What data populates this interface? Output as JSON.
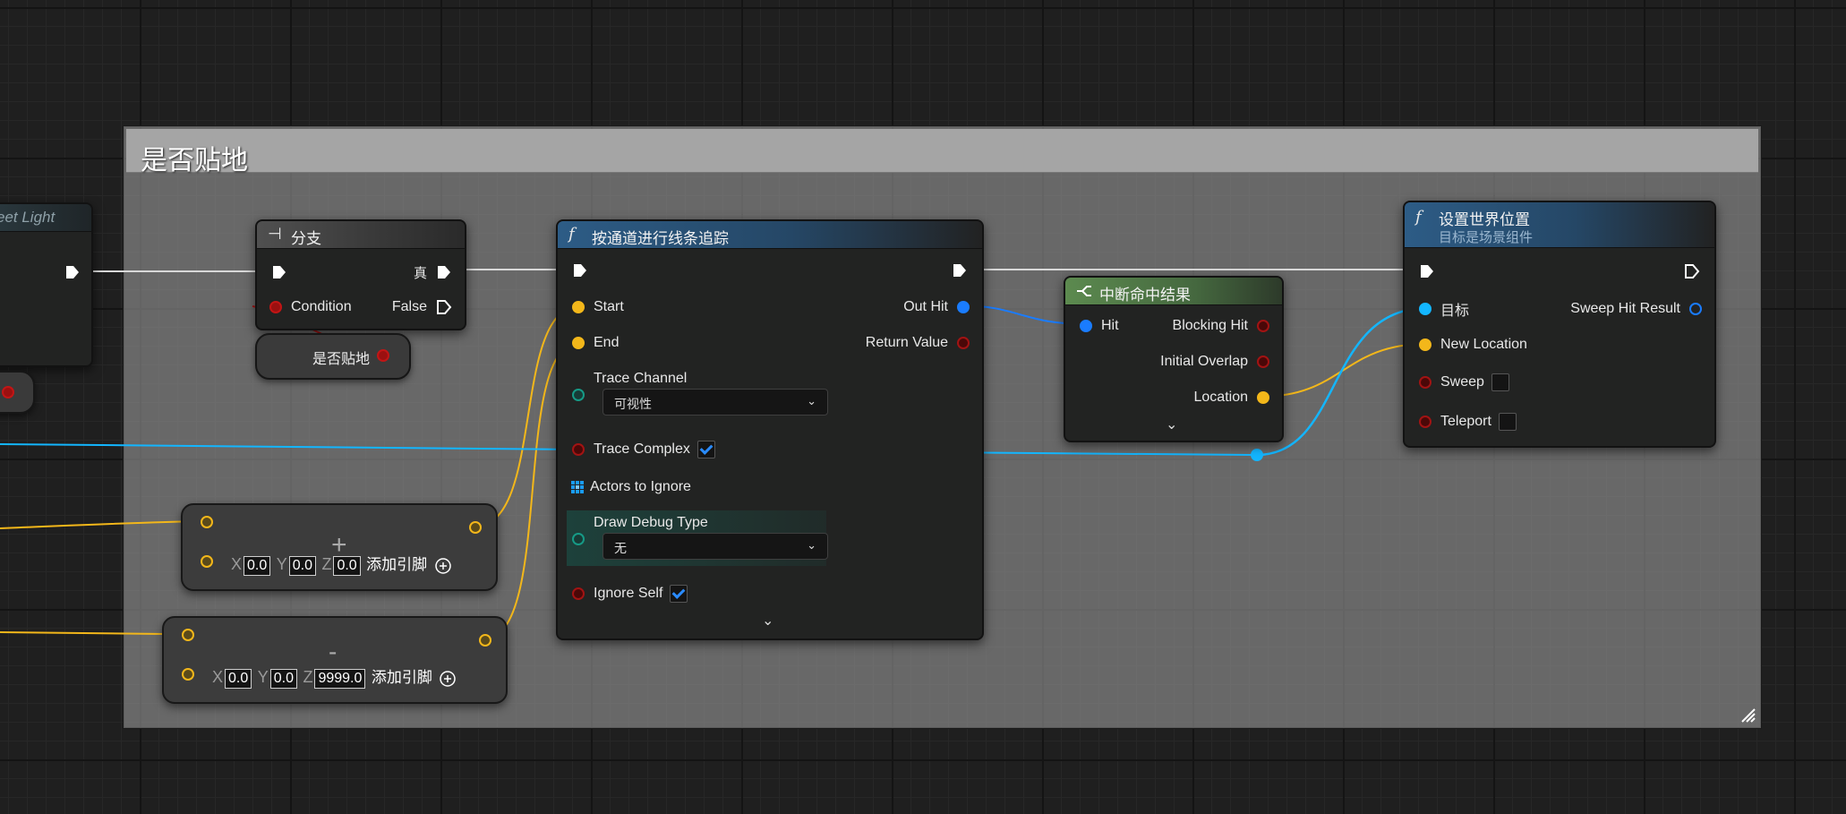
{
  "comment": {
    "title": "是否贴地"
  },
  "left_stub": {
    "title": "eet Light"
  },
  "branch_node": {
    "title": "分支",
    "exec_in": "",
    "true_label": "真",
    "condition_label": "Condition",
    "false_label": "False"
  },
  "variable_node": {
    "label": "是否贴地"
  },
  "line_trace": {
    "title": "按通道进行线条追踪",
    "start_label": "Start",
    "end_label": "End",
    "out_hit_label": "Out Hit",
    "return_value_label": "Return Value",
    "trace_channel_label": "Trace Channel",
    "trace_channel_value": "可视性",
    "trace_complex_label": "Trace Complex",
    "trace_complex_checked": true,
    "actors_to_ignore_label": "Actors to Ignore",
    "draw_debug_label": "Draw Debug Type",
    "draw_debug_value": "无",
    "ignore_self_label": "Ignore Self",
    "ignore_self_checked": true
  },
  "break_hit": {
    "title": "中断命中结果",
    "hit_label": "Hit",
    "blocking_hit_label": "Blocking Hit",
    "initial_overlap_label": "Initial Overlap",
    "location_label": "Location"
  },
  "set_world_location": {
    "title": "设置世界位置",
    "subtitle": "目标是场景组件",
    "target_label": "目标",
    "new_location_label": "New Location",
    "sweep_label": "Sweep",
    "teleport_label": "Teleport",
    "sweep_hit_result_label": "Sweep Hit Result"
  },
  "make_vector_1": {
    "op": "+",
    "x_label": "X",
    "x_value": "0.0",
    "y_label": "Y",
    "y_value": "0.0",
    "z_label": "Z",
    "z_value": "0.0",
    "add_pin_label": "添加引脚"
  },
  "make_vector_2": {
    "op": "-",
    "x_label": "X",
    "x_value": "0.0",
    "y_label": "Y",
    "y_value": "0.0",
    "z_label": "Z",
    "z_value": "9999.0",
    "add_pin_label": "添加引脚"
  },
  "colors": {
    "exec_wire": "#e0e0e0",
    "vector_wire": "#f3b71a",
    "hit_wire": "#1a7cff",
    "object_wire": "#13b6ff",
    "bool_wire": "#a21313"
  }
}
